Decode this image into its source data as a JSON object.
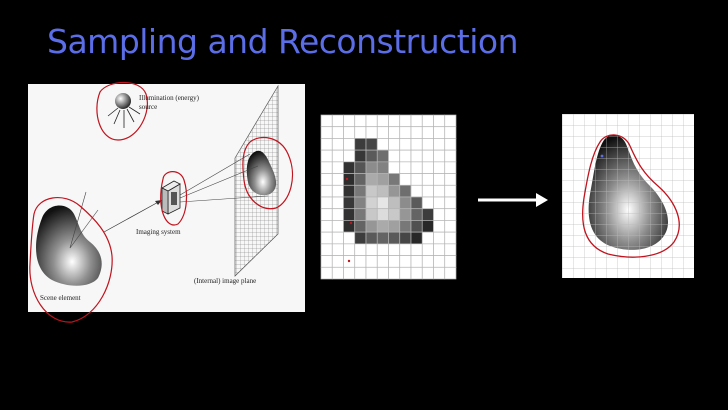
{
  "slide": {
    "title": "Sampling and Reconstruction"
  },
  "figure": {
    "illumination_label_1": "Illumination (energy)",
    "illumination_label_2": "source",
    "imaging_system_label": "Imaging system",
    "image_plane_label": "(Internal) image plane",
    "scene_element_label": "Scene element"
  },
  "colors": {
    "title": "#5b6ee8",
    "annotation": "#c0141e",
    "background": "#000000",
    "arrow": "#ffffff"
  },
  "icons": {
    "process_arrow": "right-arrow-icon"
  }
}
